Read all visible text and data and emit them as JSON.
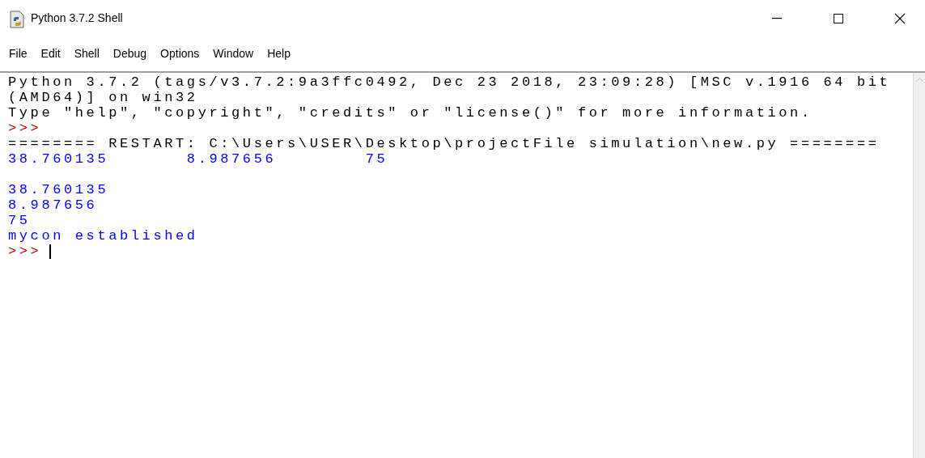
{
  "window": {
    "title": "Python 3.7.2 Shell"
  },
  "menu": [
    "File",
    "Edit",
    "Shell",
    "Debug",
    "Options",
    "Window",
    "Help"
  ],
  "lines": [
    {
      "kind": "text",
      "text": "Python 3.7.2 (tags/v3.7.2:9a3ffc0492, Dec 23 2018, 23:09:28) [MSC v.1916 64 bit"
    },
    {
      "kind": "text",
      "text": "(AMD64)] on win32"
    },
    {
      "kind": "text",
      "text": "Type \"help\", \"copyright\", \"credits\" or \"license()\" for more information."
    },
    {
      "kind": "prompt",
      "text": ">>>"
    },
    {
      "kind": "text",
      "text": "======== RESTART: C:\\Users\\USER\\Desktop\\projectFile simulation\\new.py ========"
    },
    {
      "kind": "output",
      "text": "38.760135\t8.987656\t75"
    },
    {
      "kind": "blank"
    },
    {
      "kind": "output",
      "text": "38.760135"
    },
    {
      "kind": "output",
      "text": "8.987656"
    },
    {
      "kind": "output",
      "text": "75"
    },
    {
      "kind": "output",
      "text": "mycon established"
    },
    {
      "kind": "input_prompt",
      "text": ">>>"
    }
  ]
}
